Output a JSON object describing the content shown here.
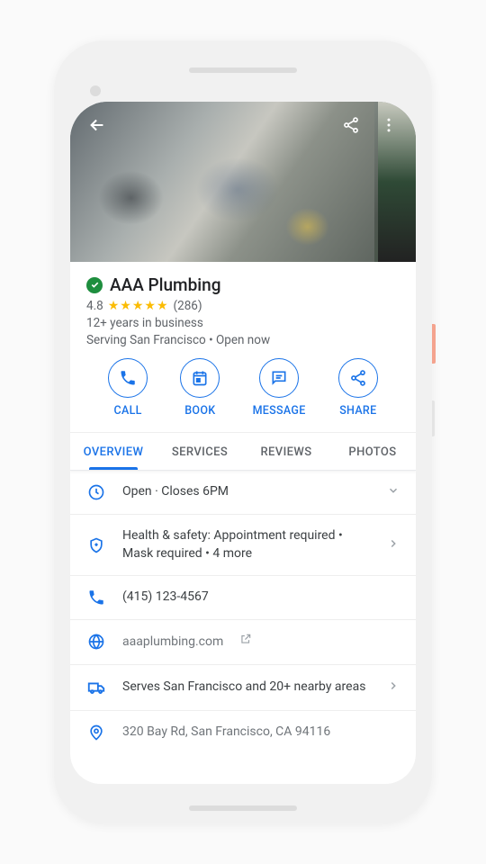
{
  "business": {
    "name": "AAA Plumbing",
    "rating": "4.8",
    "reviews": "(286)",
    "years": "12+ years in business",
    "serving_line": "Serving San Francisco  •  Open now"
  },
  "actions": {
    "call": "CALL",
    "book": "BOOK",
    "message": "MESSAGE",
    "share": "SHARE"
  },
  "tabs": {
    "overview": "OVERVIEW",
    "services": "SERVICES",
    "reviews": "REVIEWS",
    "photos": "PHOTOS"
  },
  "rows": {
    "hours": "Open · Closes 6PM",
    "safety": "Health & safety: Appointment required • Mask required • 4 more",
    "phone": "(415) 123-4567",
    "website": "aaaplumbing.com",
    "serves": "Serves San Francisco and 20+ nearby areas",
    "address": "320 Bay Rd, San Francisco, CA 94116"
  }
}
